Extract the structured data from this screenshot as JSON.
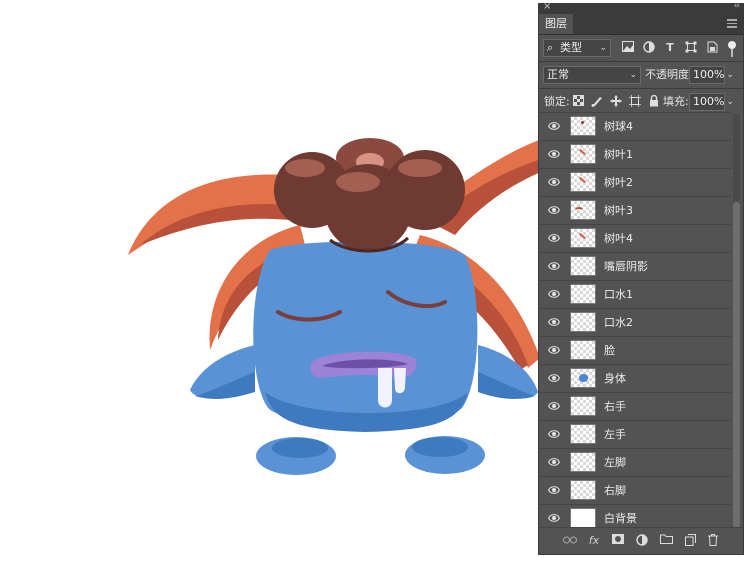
{
  "panel": {
    "title": "图层",
    "close": "×",
    "collapse": "‹‹"
  },
  "filter": {
    "kind_label": "类型",
    "icons": [
      "image-filter-icon",
      "adjustment-filter-icon",
      "type-filter-icon",
      "shape-filter-icon",
      "smart-object-filter-icon"
    ],
    "type_glyph": "T"
  },
  "blend": {
    "mode": "正常",
    "opacity_label": "不透明度:",
    "opacity_value": "100%"
  },
  "lock": {
    "label": "锁定:",
    "fill_label": "填充:",
    "fill_value": "100%"
  },
  "layers": [
    {
      "name": "树球4",
      "thumb": "dot-red"
    },
    {
      "name": "树叶1",
      "thumb": "leaf"
    },
    {
      "name": "树叶2",
      "thumb": "leaf"
    },
    {
      "name": "树叶3",
      "thumb": "arc"
    },
    {
      "name": "树叶4",
      "thumb": "leaf"
    },
    {
      "name": "嘴唇阴影",
      "thumb": "empty"
    },
    {
      "name": "口水1",
      "thumb": "empty"
    },
    {
      "name": "口水2",
      "thumb": "empty"
    },
    {
      "name": "脸",
      "thumb": "empty"
    },
    {
      "name": "身体",
      "thumb": "blue-blob"
    },
    {
      "name": "右手",
      "thumb": "empty"
    },
    {
      "name": "左手",
      "thumb": "empty"
    },
    {
      "name": "左脚",
      "thumb": "empty"
    },
    {
      "name": "右脚",
      "thumb": "empty"
    },
    {
      "name": "白背景",
      "thumb": "white"
    }
  ],
  "bottom": {
    "fx_label": "fx"
  },
  "colors": {
    "panel_bg": "#535353",
    "body_blue": "#5a92d6",
    "hair_orange": "#e3714a",
    "bulb_brown": "#6e3a32",
    "lip_purple": "#9b83d8"
  }
}
